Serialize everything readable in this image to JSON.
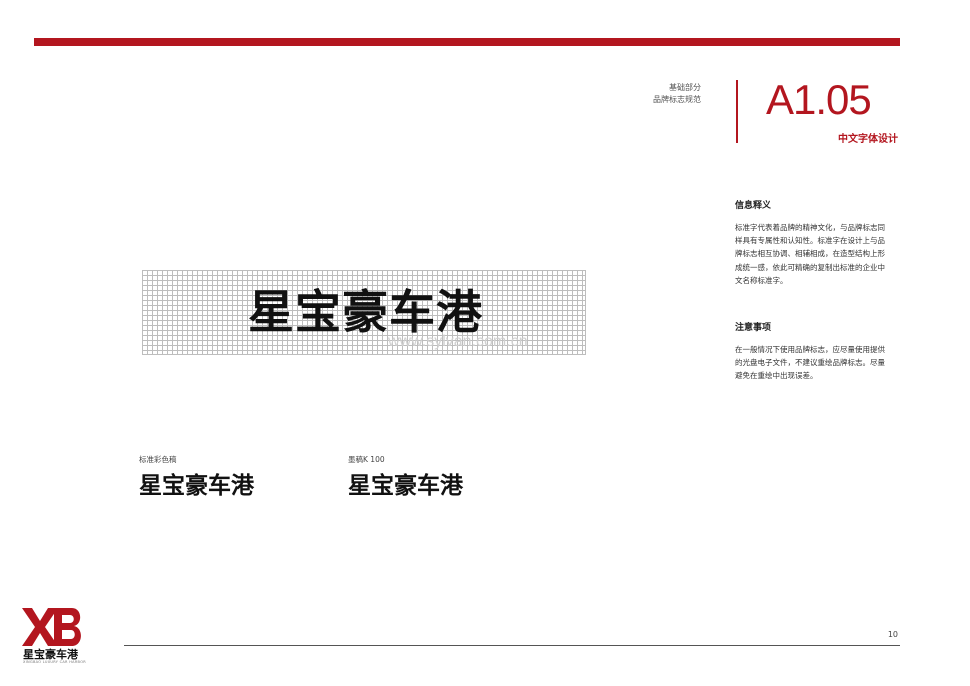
{
  "header": {
    "section_line1": "基础部分",
    "section_line2": "品牌标志规范",
    "page_code": "A1.05",
    "page_subtitle": "中文字体设计"
  },
  "sidebar": {
    "info_heading": "信息释义",
    "info_lines": [
      "标准字代表着品牌的精神文化，与品牌标志同",
      "样具有专属性和认知性。标准字在设计上与品",
      "牌标志相互协调、相辅相成，在造型结构上形",
      "成统一感，依此可精确的复制出标准的企业中",
      "文名称标准字。"
    ],
    "notes_heading": "注意事项",
    "notes_lines": [
      "在一般情况下使用品牌标志，应尽量使用提供",
      "的光盘电子文件，不建议重绘品牌标志。尽量",
      "避免在重绘中出现误差。"
    ]
  },
  "main": {
    "grid_wordmark": "星宝豪车港",
    "watermark": "www.sylvan.com.cn",
    "samples": [
      {
        "label": "标准彩色稿",
        "wordmark": "星宝豪车港"
      },
      {
        "label": "墨稿K 100",
        "wordmark": "星宝豪车港"
      }
    ]
  },
  "footer": {
    "page_number": "10",
    "logo_mark": "XB",
    "logo_cn": "星宝豪车港",
    "logo_en": "XINGBAO LUXURY CAR HARBOR"
  },
  "colors": {
    "brand_red": "#b3161f",
    "text_dark": "#111111"
  }
}
